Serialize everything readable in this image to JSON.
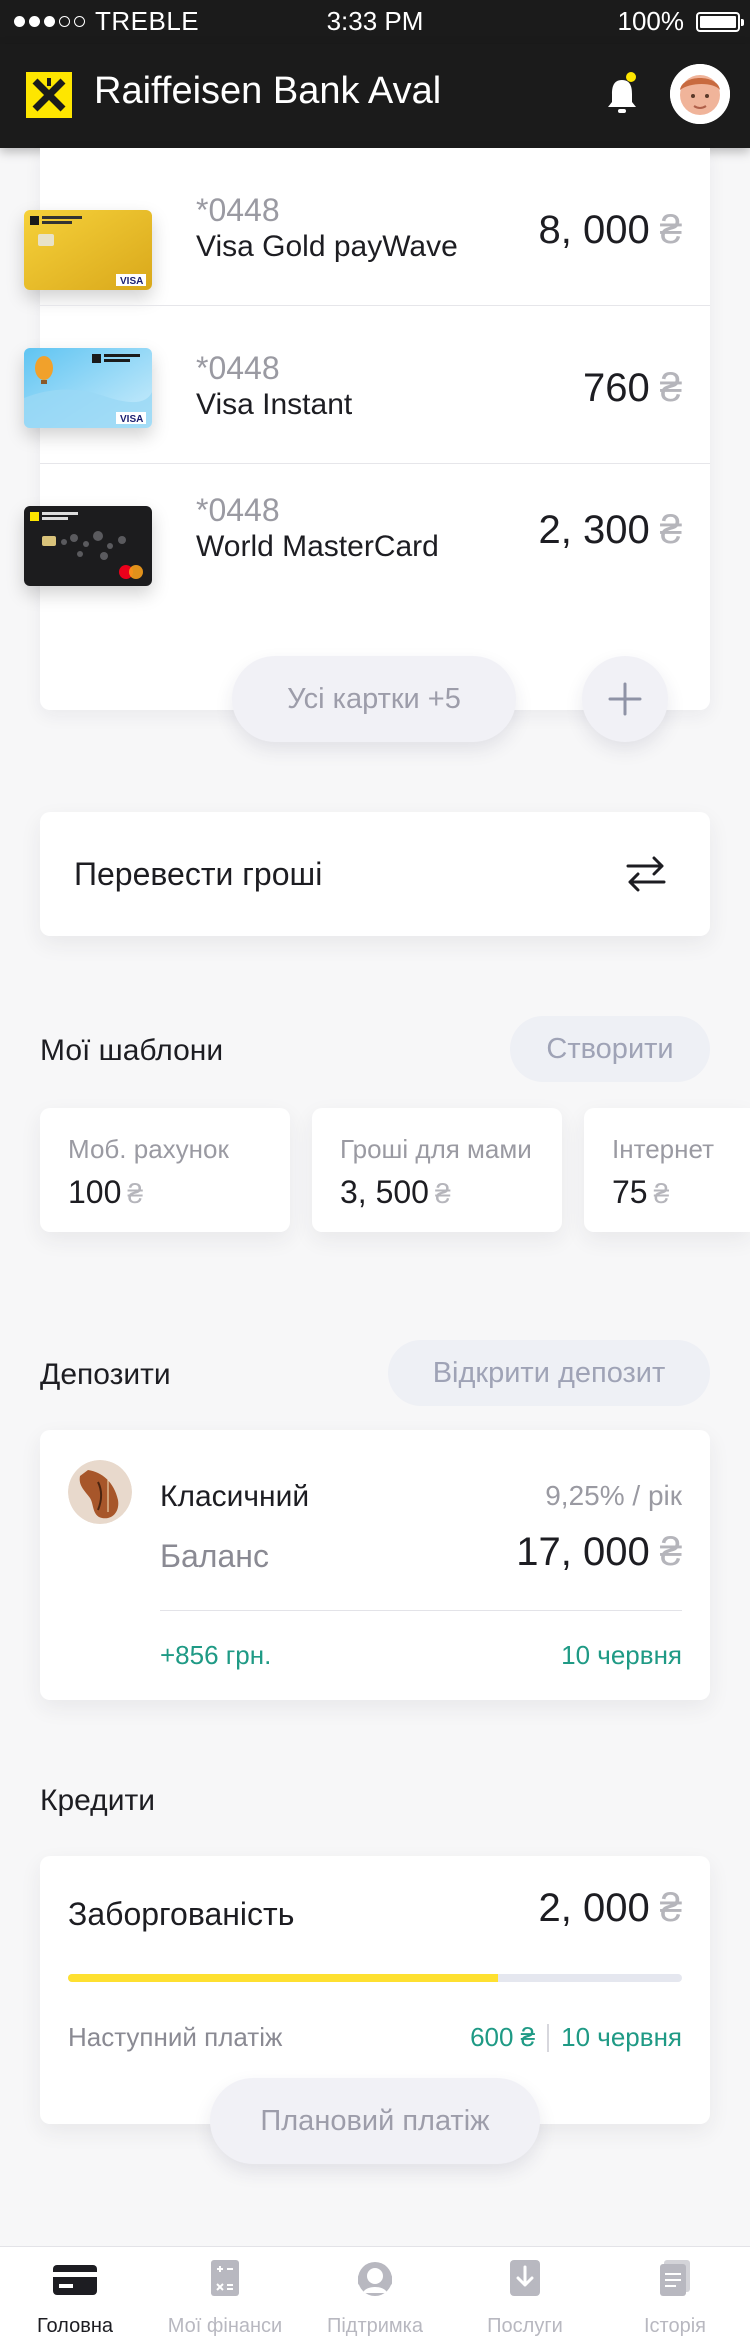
{
  "status_bar": {
    "carrier": "TREBLE",
    "time": "3:33 PM",
    "battery": "100%"
  },
  "header": {
    "title": "Raiffeisen Bank Aval"
  },
  "cards": [
    {
      "number": "*0448",
      "name": "Visa Gold payWave",
      "amount": "8, 000",
      "currency": "₴"
    },
    {
      "number": "*0448",
      "name": " Visa Instant",
      "amount": "760",
      "currency": "₴"
    },
    {
      "number": "*0448",
      "name": "World MasterCard",
      "amount": "2, 300",
      "currency": "₴"
    }
  ],
  "all_cards_label": "Усі картки +5",
  "transfer": {
    "label": "Перевести гроші"
  },
  "templates": {
    "title": "Мої шаблони",
    "create_label": "Створити",
    "items": [
      {
        "title": "Моб. рахунок",
        "amount": "100",
        "currency": "₴"
      },
      {
        "title": "Гроші для мами",
        "amount": "3, 500",
        "currency": "₴"
      },
      {
        "title": "Інтернет",
        "amount": "75",
        "currency": "₴"
      }
    ]
  },
  "deposits": {
    "title": "Депозити",
    "open_label": "Відкрити депозит",
    "item": {
      "name": "Класичний",
      "rate": "9,25% / рік",
      "balance_label": "Баланс",
      "balance": "17, 000",
      "currency": "₴",
      "income": "+856 грн.",
      "date": "10 червня"
    }
  },
  "credits": {
    "title": "Кредити",
    "debt_label": "Заборгованість",
    "debt": "2, 000",
    "currency": "₴",
    "progress": 0.7,
    "next_payment_label": "Наступний платіж",
    "next_payment_amount": "600 ₴",
    "next_payment_date": "10 червня",
    "planned_label": "Плановий платіж"
  },
  "tabs": [
    {
      "label": "Головна",
      "icon": "card-icon",
      "active": true
    },
    {
      "label": "Мої фінанси",
      "icon": "calculator-icon",
      "active": false
    },
    {
      "label": "Підтримка",
      "icon": "support-icon",
      "active": false
    },
    {
      "label": "Послуги",
      "icon": "download-icon",
      "active": false
    },
    {
      "label": "Історія",
      "icon": "history-icon",
      "active": false
    }
  ],
  "colors": {
    "brand_yellow": "#fee600",
    "header_bg": "#1b1b1b",
    "accent_green": "#1f9a85",
    "pill_text": "#9fa3b6"
  }
}
